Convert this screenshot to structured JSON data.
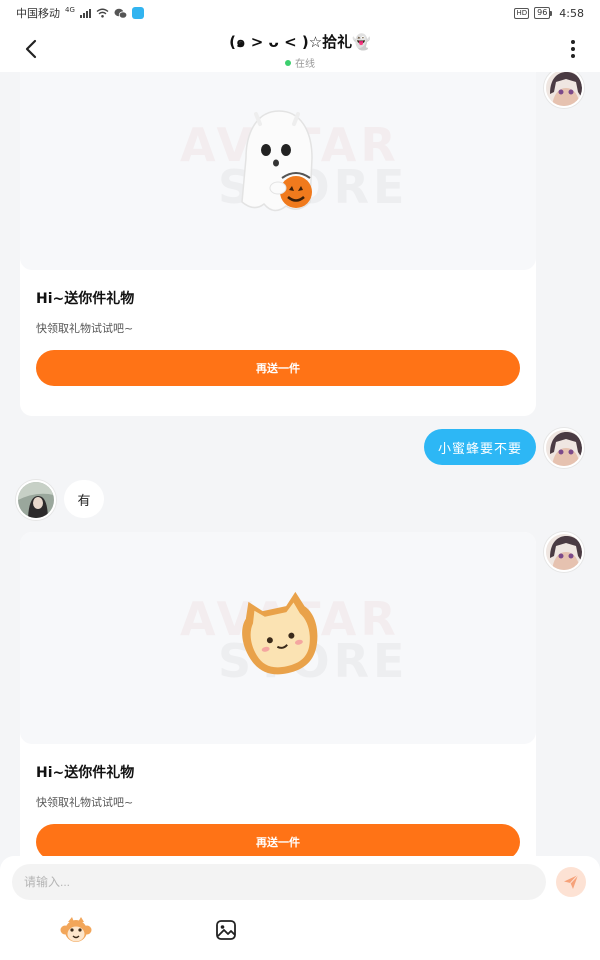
{
  "status_bar": {
    "carrier": "中国移动",
    "network": "4G",
    "hd_badge": "HD",
    "battery": "96",
    "time": "4:58"
  },
  "header": {
    "title": "(๑ > ᴗ < )☆拾礼👻",
    "status": "在线",
    "status_color": "#3ccf6e"
  },
  "messages": {
    "gift_1": {
      "title": "Hi~送你件礼物",
      "desc": "快领取礼物试试吧~",
      "button": "再送一件",
      "watermark_1": "AVATAR",
      "watermark_2": "STORE",
      "gift_icon": "ghost-pumpkin-icon"
    },
    "outgoing_text": "小蜜蜂要不要",
    "incoming_text": "有",
    "gift_2": {
      "title": "Hi~送你件礼物",
      "desc": "快领取礼物试试吧~",
      "button": "再送一件",
      "watermark_1": "AVATAR",
      "watermark_2": "STORE",
      "gift_icon": "cat-bread-icon"
    }
  },
  "input_bar": {
    "placeholder": "请输入..."
  },
  "colors": {
    "accent_orange": "#ff7316",
    "bubble_blue": "#2db7f5"
  }
}
